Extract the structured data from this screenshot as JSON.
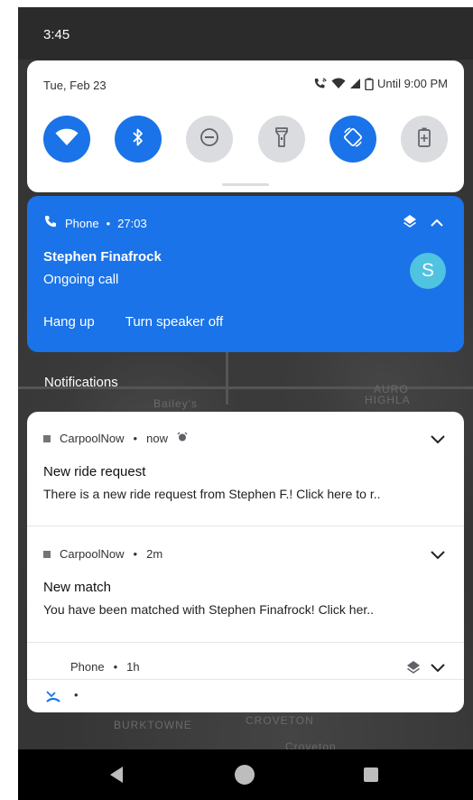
{
  "status_bar": {
    "time": "3:45"
  },
  "quick_settings": {
    "date": "Tue, Feb 23",
    "battery_text": "Until 9:00 PM",
    "tiles": [
      {
        "name": "wifi",
        "state": "on"
      },
      {
        "name": "bluetooth",
        "state": "on"
      },
      {
        "name": "do-not-disturb",
        "state": "off"
      },
      {
        "name": "flashlight",
        "state": "off"
      },
      {
        "name": "auto-rotate",
        "state": "on"
      },
      {
        "name": "battery-saver",
        "state": "off"
      }
    ]
  },
  "call": {
    "app": "Phone",
    "separator": "•",
    "duration": "27:03",
    "caller": "Stephen Finafrock",
    "status": "Ongoing call",
    "avatar_letter": "S",
    "actions": {
      "hang_up": "Hang up",
      "speaker": "Turn speaker off"
    }
  },
  "notifications_heading": "Notifications",
  "notifications": [
    {
      "app": "CarpoolNow",
      "time": "now",
      "title": "New ride request",
      "text": "There is a new ride request from Stephen F.! Click here to r.."
    },
    {
      "app": "CarpoolNow",
      "time": "2m",
      "title": "New match",
      "text": "You have been matched with Stephen Finafrock!  Click her.."
    }
  ],
  "phone_notification": {
    "app": "Phone",
    "time": "1h"
  },
  "mini_row": {
    "dot": "•"
  },
  "map_labels": [
    "Bailey's",
    "BURKTOWNE",
    "CROVETON",
    "Croveton",
    "AURO",
    "HIGHLA"
  ],
  "colors": {
    "accent": "#1a73e8",
    "avatar": "#4fc3e0",
    "tile_off": "#dadce0"
  }
}
